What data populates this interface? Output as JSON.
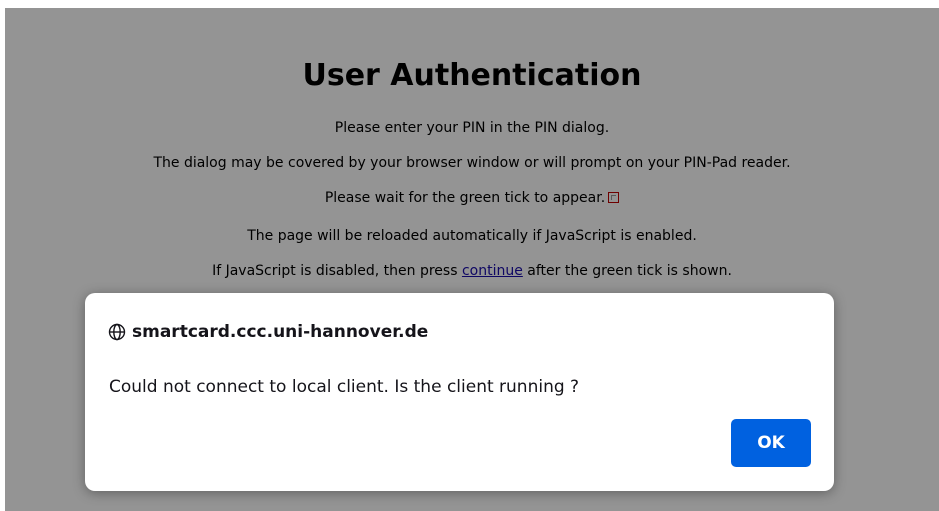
{
  "page": {
    "title": "User Authentication",
    "line1": "Please enter your PIN in the PIN dialog.",
    "line2": "The dialog may be covered by your browser window or will prompt on your PIN-Pad reader.",
    "line3": "Please wait for the green tick to appear.",
    "line4": "The page will be reloaded automatically if JavaScript is enabled.",
    "line5_before": "If JavaScript is disabled, then press ",
    "line5_link": "continue",
    "line5_after": " after the green tick is shown."
  },
  "dialog": {
    "host": "smartcard.ccc.uni-hannover.de",
    "message": "Could not connect to local client. Is the client running ?",
    "ok_label": "OK",
    "globe_icon": "globe-icon"
  },
  "colors": {
    "overlay": "#7a7a7a",
    "ok_button": "#0061e0",
    "link": "#1a0dab"
  }
}
